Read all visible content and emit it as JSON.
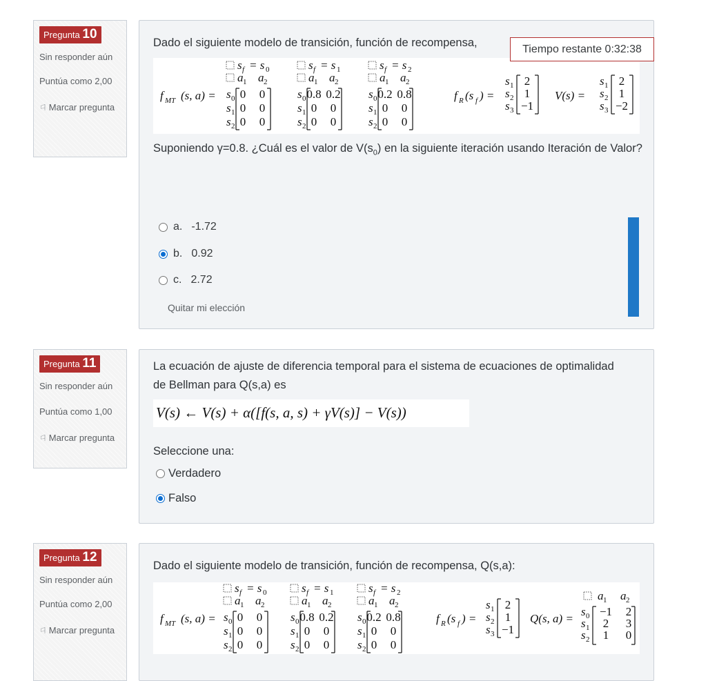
{
  "questions": [
    {
      "label": "Pregunta",
      "number": "10",
      "state": "Sin responder aún",
      "grade": "Puntúa como 2,00",
      "flag_label": "Marcar pregunta",
      "text_intro": "Dado el siguiente modelo de transición, función de recompensa,",
      "text_question": "Suponiendo γ=0.8. ¿Cuál es el valor de V(s",
      "text_question_sub": "0",
      "text_question_end": ") en la siguiente iteración usando Iteración de Valor?",
      "options": [
        {
          "letter": "a.",
          "value": "-1.72",
          "checked": false
        },
        {
          "letter": "b.",
          "value": "0.92",
          "checked": true
        },
        {
          "letter": "c.",
          "value": "2.72",
          "checked": false
        }
      ],
      "clear_label": "Quitar mi elección"
    },
    {
      "label": "Pregunta",
      "number": "11",
      "state": "Sin responder aún",
      "grade": "Puntúa como 1,00",
      "flag_label": "Marcar pregunta",
      "text_intro": "La ecuación de ajuste de diferencia temporal para el sistema de ecuaciones de optimalidad de Bellman para Q(s,a) es",
      "prompt": "Seleccione una:",
      "options": [
        {
          "value": "Verdadero",
          "checked": false
        },
        {
          "value": "Falso",
          "checked": true
        }
      ]
    },
    {
      "label": "Pregunta",
      "number": "12",
      "state": "Sin responder aún",
      "grade": "Puntúa como 2,00",
      "flag_label": "Marcar pregunta",
      "text_intro": "Dado el siguiente modelo de transición, función de recompensa, Q(s,a):"
    }
  ],
  "timer": "Tiempo restante 0:32:38",
  "math": {
    "fmt": "f",
    "fmt_sub": "MT",
    "fr": "f",
    "fr_sub": "R",
    "v": "V(s) =",
    "q": "Q(s, a) =",
    "sf_heads": [
      "s_f = s_0",
      "s_f = s_1",
      "s_f = s_2"
    ],
    "actions": [
      "a_1",
      "a_2"
    ],
    "states3": [
      "s_0",
      "s_1",
      "s_2"
    ],
    "states_r": [
      "s_1",
      "s_2",
      "s_3"
    ],
    "t0": [
      [
        "0",
        "0"
      ],
      [
        "0",
        "0"
      ],
      [
        "0",
        "0"
      ]
    ],
    "t1": [
      [
        "0.8",
        "0.2"
      ],
      [
        "0",
        "0"
      ],
      [
        "0",
        "0"
      ]
    ],
    "t2": [
      [
        "0.2",
        "0.8"
      ],
      [
        "0",
        "0"
      ],
      [
        "0",
        "0"
      ]
    ],
    "r": [
      "2",
      "1",
      "−1"
    ],
    "v_vals": [
      "2",
      "1",
      "−2"
    ],
    "q_vals": [
      [
        "−1",
        "2"
      ],
      [
        "2",
        "3"
      ],
      [
        "1",
        "0"
      ]
    ],
    "td_equation": "V(s) ← V(s) + α([f_R(s, a, s_f) + γV(s_f)] − V(s))"
  },
  "colors": {
    "badge": "#b22f2f",
    "accent": "#0b6dd1",
    "scrollbar": "#1f78c7"
  }
}
